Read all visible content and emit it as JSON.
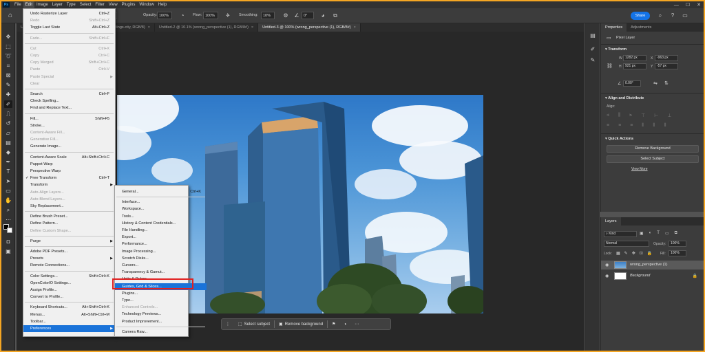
{
  "menubar": {
    "logo": "Ps",
    "items": [
      "File",
      "Edit",
      "Image",
      "Layer",
      "Type",
      "Select",
      "Filter",
      "View",
      "Plugins",
      "Window",
      "Help"
    ],
    "active": "Edit"
  },
  "optionsbar": {
    "opacity_label": "Opacity:",
    "opacity_value": "100%",
    "flow_label": "Flow:",
    "flow_value": "100%",
    "smoothing_label": "Smoothing:",
    "smoothing_value": "10%",
    "angle_value": "0°",
    "share_label": "Share"
  },
  "tabs": [
    {
      "label": "Un",
      "active": false
    },
    {
      "label": "ildings-city, RGB/8)",
      "active": false
    },
    {
      "label": "Untitled-2 @ 10.1% (wrong_perspective (1), RGB/8#)",
      "active": false
    },
    {
      "label": "Untitled-3 @ 100% (wrong_perspective (1), RGB/8#)",
      "active": true
    }
  ],
  "context_bar": {
    "select_subject": "Select subject",
    "remove_background": "Remove background"
  },
  "properties": {
    "tabs": [
      "Properties",
      "Adjustments"
    ],
    "layer_type": "Pixel Layer",
    "transform_label": "Transform",
    "w_label": "W",
    "w_value": "1282 px",
    "h_label": "H",
    "h_value": "921 px",
    "x_label": "X",
    "x_value": "-963 px",
    "y_label": "Y",
    "y_value": "-57 px",
    "angle_value": "0.00°",
    "align_label": "Align and Distribute",
    "align_sub": "Align:",
    "quick_actions_label": "Quick Actions",
    "remove_bg_btn": "Remove Background",
    "select_subject_btn": "Select Subject",
    "view_more": "View More"
  },
  "layers": {
    "tab": "Layers",
    "kind_label": "Kind",
    "blend_mode": "Normal",
    "opacity_label": "Opacity:",
    "opacity_value": "100%",
    "lock_label": "Lock:",
    "fill_label": "Fill:",
    "fill_value": "100%",
    "items": [
      {
        "name": "wrong_perspective (1)",
        "selected": true
      },
      {
        "name": "Background",
        "selected": false
      }
    ]
  },
  "edit_menu": {
    "items": [
      {
        "label": "Undo Rasterize Layer",
        "shortcut": "Ctrl+Z"
      },
      {
        "label": "Redo",
        "shortcut": "Shift+Ctrl+Z",
        "disabled": true
      },
      {
        "label": "Toggle Last State",
        "shortcut": "Alt+Ctrl+Z"
      },
      {
        "sep": true
      },
      {
        "label": "Fade...",
        "shortcut": "Shift+Ctrl+F",
        "disabled": true
      },
      {
        "sep": true
      },
      {
        "label": "Cut",
        "shortcut": "Ctrl+X",
        "disabled": true
      },
      {
        "label": "Copy",
        "shortcut": "Ctrl+C",
        "disabled": true
      },
      {
        "label": "Copy Merged",
        "shortcut": "Shift+Ctrl+C",
        "disabled": true
      },
      {
        "label": "Paste",
        "shortcut": "Ctrl+V",
        "disabled": true
      },
      {
        "label": "Paste Special",
        "submenu": true,
        "disabled": true
      },
      {
        "label": "Clear",
        "disabled": true
      },
      {
        "sep": true
      },
      {
        "label": "Search",
        "shortcut": "Ctrl+F"
      },
      {
        "label": "Check Spelling..."
      },
      {
        "label": "Find and Replace Text..."
      },
      {
        "sep": true
      },
      {
        "label": "Fill...",
        "shortcut": "Shift+F5"
      },
      {
        "label": "Stroke..."
      },
      {
        "label": "Content-Aware Fill...",
        "disabled": true
      },
      {
        "label": "Generative Fill...",
        "disabled": true
      },
      {
        "label": "Generate Image..."
      },
      {
        "sep": true
      },
      {
        "label": "Content-Aware Scale",
        "shortcut": "Alt+Shift+Ctrl+C"
      },
      {
        "label": "Puppet Warp"
      },
      {
        "label": "Perspective Warp"
      },
      {
        "label": "Free Transform",
        "shortcut": "Ctrl+T",
        "checked": true
      },
      {
        "label": "Transform",
        "submenu": true
      },
      {
        "label": "Auto-Align Layers...",
        "disabled": true
      },
      {
        "label": "Auto-Blend Layers...",
        "disabled": true
      },
      {
        "label": "Sky Replacement..."
      },
      {
        "sep": true
      },
      {
        "label": "Define Brush Preset..."
      },
      {
        "label": "Define Pattern..."
      },
      {
        "label": "Define Custom Shape...",
        "disabled": true
      },
      {
        "sep": true
      },
      {
        "label": "Purge",
        "submenu": true
      },
      {
        "sep": true
      },
      {
        "label": "Adobe PDF Presets..."
      },
      {
        "label": "Presets",
        "submenu": true
      },
      {
        "label": "Remote Connections..."
      },
      {
        "sep": true
      },
      {
        "label": "Color Settings...",
        "shortcut": "Shift+Ctrl+K"
      },
      {
        "label": "OpenColorIO Settings..."
      },
      {
        "label": "Assign Profile..."
      },
      {
        "label": "Convert to Profile..."
      },
      {
        "sep": true
      },
      {
        "label": "Keyboard Shortcuts...",
        "shortcut": "Alt+Shift+Ctrl+K"
      },
      {
        "label": "Menus...",
        "shortcut": "Alt+Shift+Ctrl+M"
      },
      {
        "label": "Toolbar..."
      },
      {
        "label": "Preferences",
        "submenu": true,
        "highlighted": true
      }
    ]
  },
  "pref_menu": {
    "items": [
      {
        "label": "General...",
        "shortcut": "Ctrl+K"
      },
      {
        "sep": true
      },
      {
        "label": "Interface..."
      },
      {
        "label": "Workspace..."
      },
      {
        "label": "Tools..."
      },
      {
        "label": "History & Content Credentials..."
      },
      {
        "label": "File Handling..."
      },
      {
        "label": "Export..."
      },
      {
        "label": "Performance..."
      },
      {
        "label": "Image Processing..."
      },
      {
        "label": "Scratch Disks..."
      },
      {
        "label": "Cursors..."
      },
      {
        "label": "Transparency & Gamut..."
      },
      {
        "label": "Units & Rulers..."
      },
      {
        "label": "Guides, Grid & Slices...",
        "highlighted": true
      },
      {
        "label": "Plugins..."
      },
      {
        "label": "Type..."
      },
      {
        "label": "Enhanced Controls...",
        "disabled": true
      },
      {
        "label": "Technology Previews..."
      },
      {
        "label": "Product Improvement..."
      },
      {
        "sep": true
      },
      {
        "label": "Camera Raw..."
      }
    ]
  },
  "colors": {
    "accent": "#1a73d9",
    "share": "#1473e6",
    "annotation_border": "#e02020",
    "frame_border": "#f5a623"
  }
}
